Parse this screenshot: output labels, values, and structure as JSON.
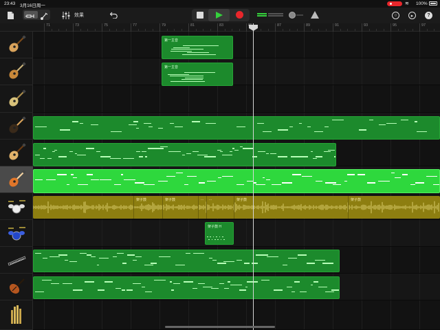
{
  "status_bar": {
    "time": "23:43",
    "date": "3月16日周一",
    "battery": "100%",
    "recording_indicator_color": "#e8262b"
  },
  "toolbar": {
    "items": [
      {
        "name": "my-songs-icon"
      },
      {
        "name": "tracks-view-icon",
        "selected": true
      },
      {
        "name": "track-controls-icon"
      },
      {
        "name": "mixer-eq-icon"
      },
      {
        "name": "undo-icon"
      },
      {
        "name": "stop-icon"
      },
      {
        "name": "play-icon",
        "color": "#35d13c"
      },
      {
        "name": "record-icon",
        "color": "#e8262b"
      },
      {
        "name": "master-volume-slider"
      },
      {
        "name": "metronome-icon"
      },
      {
        "name": "loop-browser-icon"
      },
      {
        "name": "settings-icon"
      },
      {
        "name": "help-icon"
      }
    ],
    "fx_label": "效果"
  },
  "ruler": {
    "marks": [
      "71",
      "73",
      "75",
      "77",
      "79",
      "81",
      "83",
      "85",
      "87",
      "89",
      "91",
      "93",
      "95",
      "97"
    ],
    "playhead_bar": "85"
  },
  "tracks": [
    {
      "instrument": "acoustic-guitar-icon",
      "regions": [
        {
          "name": "第一主音"
        }
      ]
    },
    {
      "instrument": "electric-guitar-sunburst-icon",
      "regions": [
        {
          "name": "第一主音"
        }
      ]
    },
    {
      "instrument": "electric-guitar-gold-icon",
      "regions": []
    },
    {
      "instrument": "electric-guitar-dark-icon",
      "regions": [
        {
          "name": ""
        }
      ]
    },
    {
      "instrument": "acoustic-guitar-2-icon",
      "regions": [
        {
          "name": ""
        }
      ]
    },
    {
      "instrument": "electric-guitar-orange-icon",
      "selected": true,
      "regions": [
        {
          "name": ""
        }
      ]
    },
    {
      "instrument": "drum-kit-icon",
      "regions": [
        {
          "name": "架子鼓"
        },
        {
          "name": "架子鼓"
        },
        {
          "name": "..."
        },
        {
          "name": "..."
        },
        {
          "name": "架子鼓"
        },
        {
          "name": "架子鼓"
        }
      ]
    },
    {
      "instrument": "blue-drum-kit-icon",
      "regions": [
        {
          "name": "架子鼓 H"
        }
      ]
    },
    {
      "instrument": "keyboard-icon",
      "regions": [
        {
          "name": ""
        }
      ]
    },
    {
      "instrument": "violin-icon",
      "regions": [
        {
          "name": ""
        }
      ]
    },
    {
      "instrument": "organ-pipes-icon",
      "regions": []
    }
  ],
  "colors": {
    "midi_region": "#1c8a2c",
    "midi_region_selected": "#2ed83d",
    "audio_region": "#8d7e10",
    "background": "#121212"
  }
}
